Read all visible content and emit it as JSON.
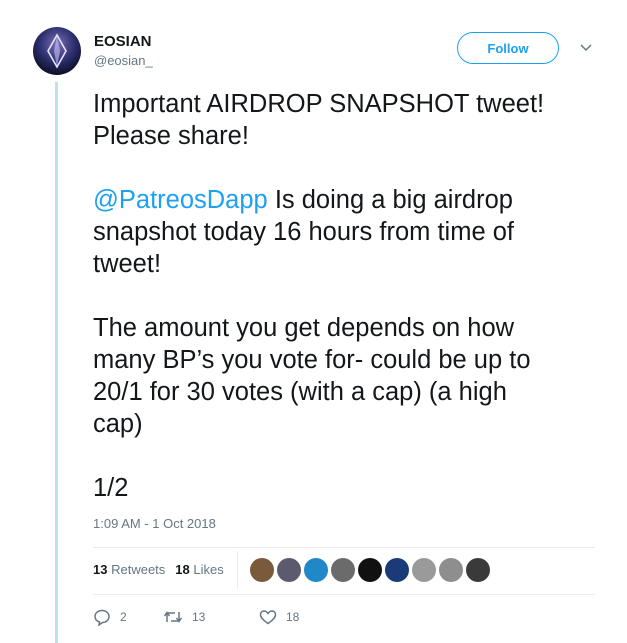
{
  "author": {
    "display_name": "EOSIAN",
    "handle": "@eosian_"
  },
  "follow_label": "Follow",
  "tweet": {
    "line1": "Important AIRDROP SNAPSHOT tweet!",
    "line2": "Please share!",
    "mention": "@PatreosDapp",
    "p2_rest": " Is doing a big airdrop",
    "p2_l2": "snapshot today 16 hours from time of",
    "p2_l3": "tweet!",
    "p3_l1": "The amount you get depends on how",
    "p3_l2": "many BP’s you vote for- could be up to",
    "p3_l3": "20/1 for 30 votes (with a cap) (a high",
    "p3_l4": "cap)",
    "p4": "1/2"
  },
  "timestamp": "1:09 AM - 1 Oct 2018",
  "stats": {
    "retweets_count": "13",
    "retweets_label": "Retweets",
    "likes_count": "18",
    "likes_label": "Likes"
  },
  "likers": [
    {
      "name": "avatar-1",
      "color": "#7a5a3a"
    },
    {
      "name": "avatar-2",
      "color": "#5c5a6e"
    },
    {
      "name": "avatar-3",
      "color": "#1e88c8"
    },
    {
      "name": "avatar-4",
      "color": "#6b6b6b"
    },
    {
      "name": "avatar-5",
      "color": "#111111"
    },
    {
      "name": "avatar-6",
      "color": "#1b3a78"
    },
    {
      "name": "avatar-7",
      "color": "#9a9a9a"
    },
    {
      "name": "avatar-8",
      "color": "#8e8e8e"
    },
    {
      "name": "avatar-9",
      "color": "#3a3a3a"
    }
  ],
  "actions": {
    "reply_count": "2",
    "retweet_count": "13",
    "like_count": "18"
  },
  "icons": {
    "reply": "reply-icon",
    "retweet": "retweet-icon",
    "like": "heart-icon",
    "more": "chevron-down-icon"
  }
}
